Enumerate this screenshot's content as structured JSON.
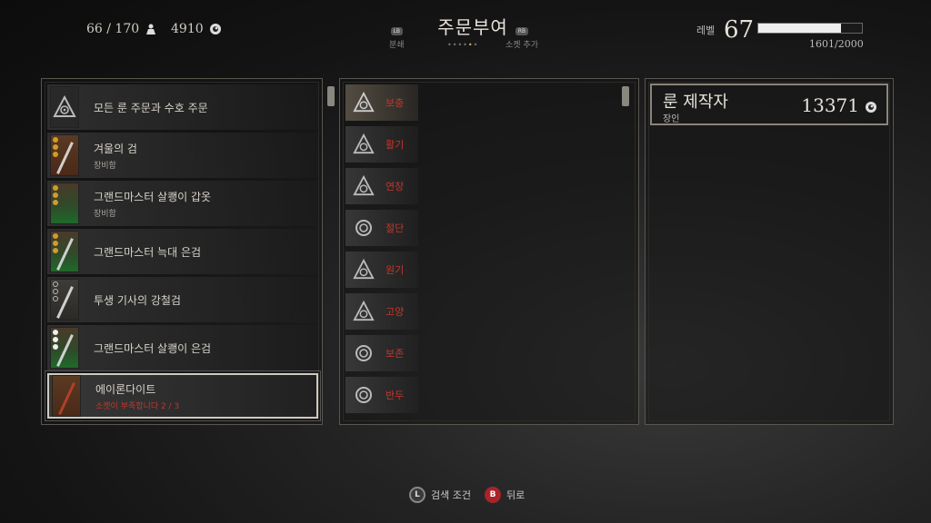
{
  "hud": {
    "weight": "66 / 170",
    "weight_icon": "weight-icon",
    "crowns": "4910",
    "crowns_icon": "crown-coin-icon"
  },
  "header": {
    "title": "주문부여",
    "left_tab": {
      "button": "LB",
      "label": "분쇄"
    },
    "right_tab": {
      "button": "RB",
      "label": "소켓 추가"
    },
    "page_dots": {
      "total": 6,
      "active_index": 4
    }
  },
  "level": {
    "label": "레벨",
    "value": "67",
    "xp_text": "1601/2000",
    "xp_fraction": 0.8
  },
  "item_list": [
    {
      "name": "모든 룬 주문과 수호 주문",
      "sub": "",
      "thumb": "rune",
      "pips": []
    },
    {
      "name": "겨울의 검",
      "sub": "장비함",
      "thumb": "brown",
      "pips": [
        "gold",
        "gold",
        "gold"
      ]
    },
    {
      "name": "그랜드마스터 살쾡이 갑옷",
      "sub": "장비함",
      "thumb": "green",
      "pips": [
        "gold",
        "gold",
        "gold"
      ]
    },
    {
      "name": "그랜드마스터 늑대 은검",
      "sub": "",
      "thumb": "green",
      "pips": [
        "gold",
        "gold",
        "gold"
      ]
    },
    {
      "name": "투생 기사의 강철검",
      "sub": "",
      "thumb": "grey",
      "pips": [
        "ring",
        "ring",
        "ring"
      ]
    },
    {
      "name": "그랜드마스터 살쾡이 은검",
      "sub": "",
      "thumb": "green",
      "pips": [
        "white",
        "white",
        "white"
      ]
    },
    {
      "name": "에이론다이트",
      "sub": "소켓이 부족합니다 2 / 3",
      "thumb": "brown",
      "pips": [],
      "selected": true,
      "warning": true
    }
  ],
  "enchant_list": [
    {
      "name": "보충",
      "active": true,
      "icon": "triangle-spiral-icon"
    },
    {
      "name": "활기",
      "icon": "triangle-spiral-icon"
    },
    {
      "name": "연장",
      "icon": "triangle-spiral-icon"
    },
    {
      "name": "절단",
      "icon": "spiral-icon"
    },
    {
      "name": "원기",
      "icon": "triangle-spiral-icon"
    },
    {
      "name": "고양",
      "icon": "triangle-spiral-icon"
    },
    {
      "name": "보존",
      "icon": "spiral-icon"
    },
    {
      "name": "반두",
      "icon": "spiral-icon"
    }
  ],
  "merchant": {
    "name": "룬 제작자",
    "sub": "장인",
    "gold": "13371",
    "coin_icon": "crown-coin-icon"
  },
  "footer": {
    "filter": {
      "button": "L",
      "label": "검색 조건"
    },
    "back": {
      "button": "B",
      "label": "뒤로"
    }
  },
  "colors": {
    "warning_red": "#c8352a",
    "pip_gold": "#d39a2a",
    "b_button": "#a8232a"
  }
}
